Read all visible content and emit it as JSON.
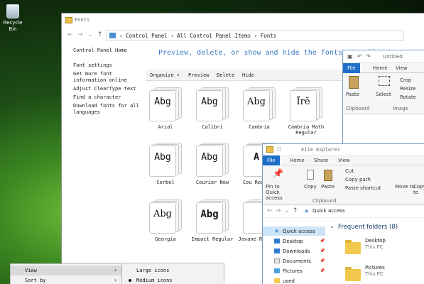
{
  "desktop": {
    "recycle_bin": "Recycle Bin"
  },
  "fonts_window": {
    "title": "Fonts",
    "breadcrumbs": [
      "Control Panel",
      "All Control Panel Items",
      "Fonts"
    ],
    "left_links": [
      "Control Panel Home",
      "Font settings",
      "Get more font information online",
      "Adjust ClearType text",
      "Find a character",
      "Download fonts for all languages"
    ],
    "heading": "Preview, delete, or show and hide the fonts installed",
    "toolbar": [
      "Organize ▾",
      "Preview",
      "Delete",
      "Hide"
    ],
    "tiles": [
      {
        "name": "Arial",
        "glyph": "Abg"
      },
      {
        "name": "Calibri",
        "glyph": "Abg"
      },
      {
        "name": "Cambria",
        "glyph": "Abg"
      },
      {
        "name": "Cambria Math Regular",
        "glyph": "Ïrĕ"
      },
      {
        "name": "Corbel",
        "glyph": "Abg"
      },
      {
        "name": "Courier New",
        "glyph": "Abg"
      },
      {
        "name": "Cou Regular",
        "glyph": "A"
      },
      {
        "name": "Georgia",
        "glyph": "Abg"
      },
      {
        "name": "Impact Regular",
        "glyph": "Abg"
      },
      {
        "name": "Javane Regular",
        "glyph": ""
      }
    ]
  },
  "paint_window": {
    "title": "Untitled",
    "tabs": [
      "File",
      "Home",
      "View"
    ],
    "ribbon": {
      "paste": "Paste",
      "select": "Select",
      "crop": "Crop",
      "resize": "Resize",
      "rotate": "Rotate",
      "clipboard": "Clipboard",
      "image": "Image"
    }
  },
  "explorer": {
    "title": "File Explorer",
    "tabs": [
      "File",
      "Home",
      "Share",
      "View"
    ],
    "ribbon": {
      "pin": "Pin to Quick access",
      "copy": "Copy",
      "paste": "Paste",
      "cut": "Cut",
      "copy_path": "Copy path",
      "paste_shortcut": "Paste shortcut",
      "move_to": "Move to",
      "copy_to": "Copy to",
      "clipboard": "Clipboard"
    },
    "address": "Quick access",
    "nav": [
      "Quick access",
      "Desktop",
      "Downloads",
      "Documents",
      "Pictures",
      "used"
    ],
    "section": "Frequent folders (8)",
    "folders": [
      {
        "name": "Desktop",
        "loc": "This PC"
      },
      {
        "name": "Pictures",
        "loc": "This PC"
      }
    ]
  },
  "context_menu": {
    "items": [
      "View",
      "Sort by"
    ]
  },
  "view_submenu": {
    "items": [
      "Large icons",
      "Medium icons"
    ]
  },
  "colors": {
    "accent": "#1e6fc7",
    "link": "#3a7abf"
  }
}
